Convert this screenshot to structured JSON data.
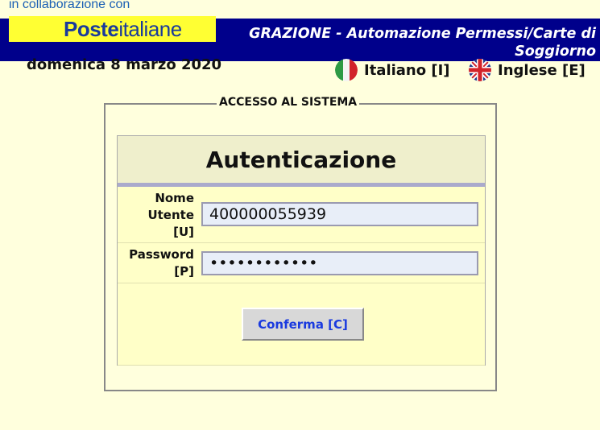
{
  "header": {
    "collaboration": "in collaborazione con",
    "logo_bold": "Poste",
    "logo_regular": "italiane",
    "title": "GRAZIONE - Automazione Permessi/Carte di Soggiorno",
    "date": "domenica 8 marzo 2020",
    "colors": {
      "bar": "#00008b",
      "logo_bg": "#ffff33",
      "page_bg": "#ffffdd"
    }
  },
  "languages": {
    "italian": {
      "label": "Italiano [I]",
      "icon": "italy-flag-icon"
    },
    "english": {
      "label": "Inglese [E]",
      "icon": "uk-flag-icon"
    }
  },
  "panel": {
    "legend": "ACCESSO AL SISTEMA",
    "heading": "Autenticazione",
    "username": {
      "label_line1": "Nome",
      "label_line2": "Utente",
      "label_line3": "[U]",
      "value": "400000055939"
    },
    "password": {
      "label_line1": "Password",
      "label_line2": "[P]",
      "value": "••••••••••••"
    },
    "confirm_label": "Conferma [C]"
  }
}
